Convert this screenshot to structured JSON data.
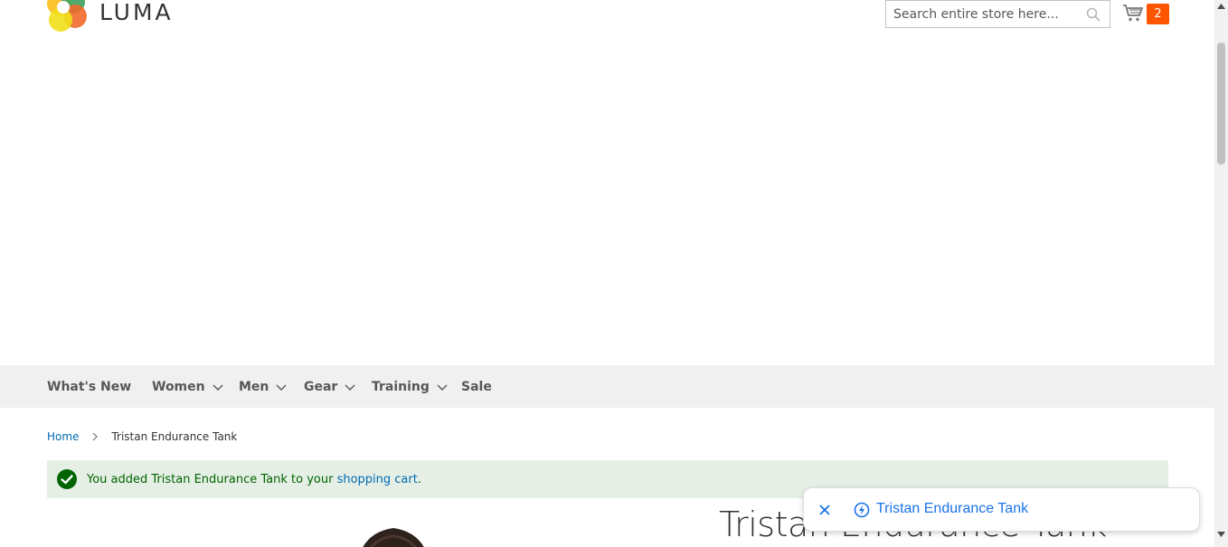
{
  "header": {
    "logo_text": "LUMA",
    "search_placeholder": "Search entire store here...",
    "cart_count": "2"
  },
  "nav": {
    "items": [
      {
        "label": "What's New",
        "has_dropdown": false
      },
      {
        "label": "Women",
        "has_dropdown": true
      },
      {
        "label": "Men",
        "has_dropdown": true
      },
      {
        "label": "Gear",
        "has_dropdown": true
      },
      {
        "label": "Training",
        "has_dropdown": true
      },
      {
        "label": "Sale",
        "has_dropdown": false
      }
    ]
  },
  "breadcrumb": {
    "home": "Home",
    "current": "Tristan Endurance Tank"
  },
  "message": {
    "prefix": "You added Tristan Endurance Tank to your ",
    "link": "shopping cart",
    "suffix": "."
  },
  "product": {
    "title": "Tristan Endurance Tank"
  },
  "popup": {
    "link_text": "Tristan Endurance Tank"
  },
  "colors": {
    "accent_orange": "#ff5501",
    "link_blue": "#006bb4",
    "success_bg": "#e5efe5",
    "success_text": "#006400",
    "popup_blue": "#1a73e8"
  },
  "icons": {
    "logo": "luma-logo-icon",
    "search": "search-icon",
    "cart": "cart-icon",
    "chevron": "chevron-down-icon",
    "success": "check-circle-icon",
    "close": "close-icon",
    "bolt": "bolt-icon"
  }
}
